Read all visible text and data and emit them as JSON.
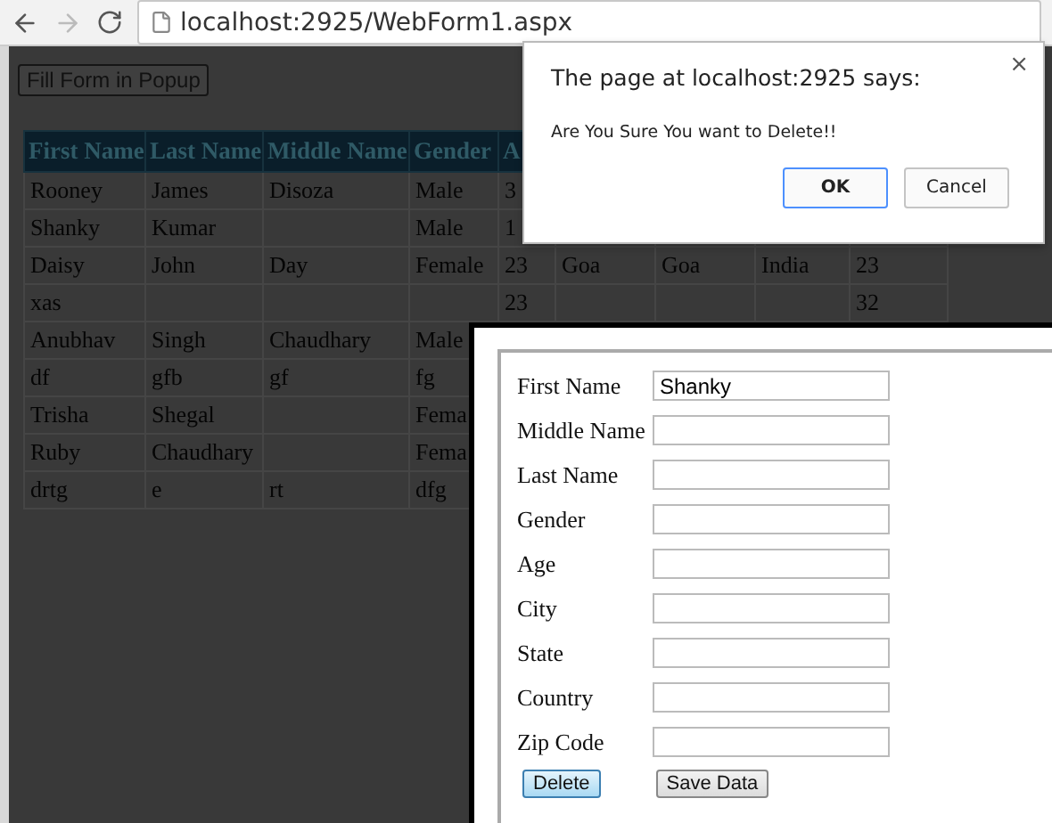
{
  "browser": {
    "url": "localhost:2925/WebForm1.aspx"
  },
  "page": {
    "popup_button": "Fill Form in Popup",
    "table": {
      "columns": [
        "First Name",
        "Last Name",
        "Middle Name",
        "Gender",
        "A"
      ],
      "rows": [
        {
          "cells": [
            "Rooney",
            "James",
            "Disoza",
            "Male",
            "3"
          ]
        },
        {
          "cells": [
            "Shanky",
            "Kumar",
            null,
            "Male",
            "1"
          ]
        },
        {
          "cells": [
            "Daisy",
            "John",
            "Day",
            "Female",
            "23",
            "Goa",
            "Goa",
            "India",
            "23"
          ]
        },
        {
          "cells": [
            "xas",
            null,
            null,
            null,
            "23",
            null,
            null,
            null,
            "32"
          ]
        },
        {
          "cells": [
            "Anubhav",
            "Singh",
            "Chaudhary",
            "Male"
          ]
        },
        {
          "cells": [
            "df",
            "gfb",
            "gf",
            "fg"
          ]
        },
        {
          "cells": [
            "Trisha",
            "Shegal",
            null,
            "Fema"
          ]
        },
        {
          "cells": [
            "Ruby",
            "Chaudhary",
            null,
            "Fema"
          ]
        },
        {
          "cells": [
            "drtg",
            "e",
            "rt",
            "dfg"
          ]
        }
      ]
    }
  },
  "popup_form": {
    "fields": [
      {
        "label": "First Name",
        "value": "Shanky"
      },
      {
        "label": "Middle Name"
      },
      {
        "label": "Last Name"
      },
      {
        "label": "Gender"
      },
      {
        "label": "Age"
      },
      {
        "label": "City"
      },
      {
        "label": "State"
      },
      {
        "label": "Country"
      },
      {
        "label": "Zip Code"
      }
    ],
    "buttons": [
      {
        "label": "Delete",
        "focused": true
      },
      {
        "label": "Save Data",
        "focused": false
      }
    ]
  },
  "alert": {
    "title": "The page at localhost:2925 says:",
    "message": "Are You Sure You want to Delete!!",
    "close": "×",
    "buttons": [
      {
        "label": "OK",
        "default": true
      },
      {
        "label": "Cancel",
        "default": false
      }
    ]
  }
}
